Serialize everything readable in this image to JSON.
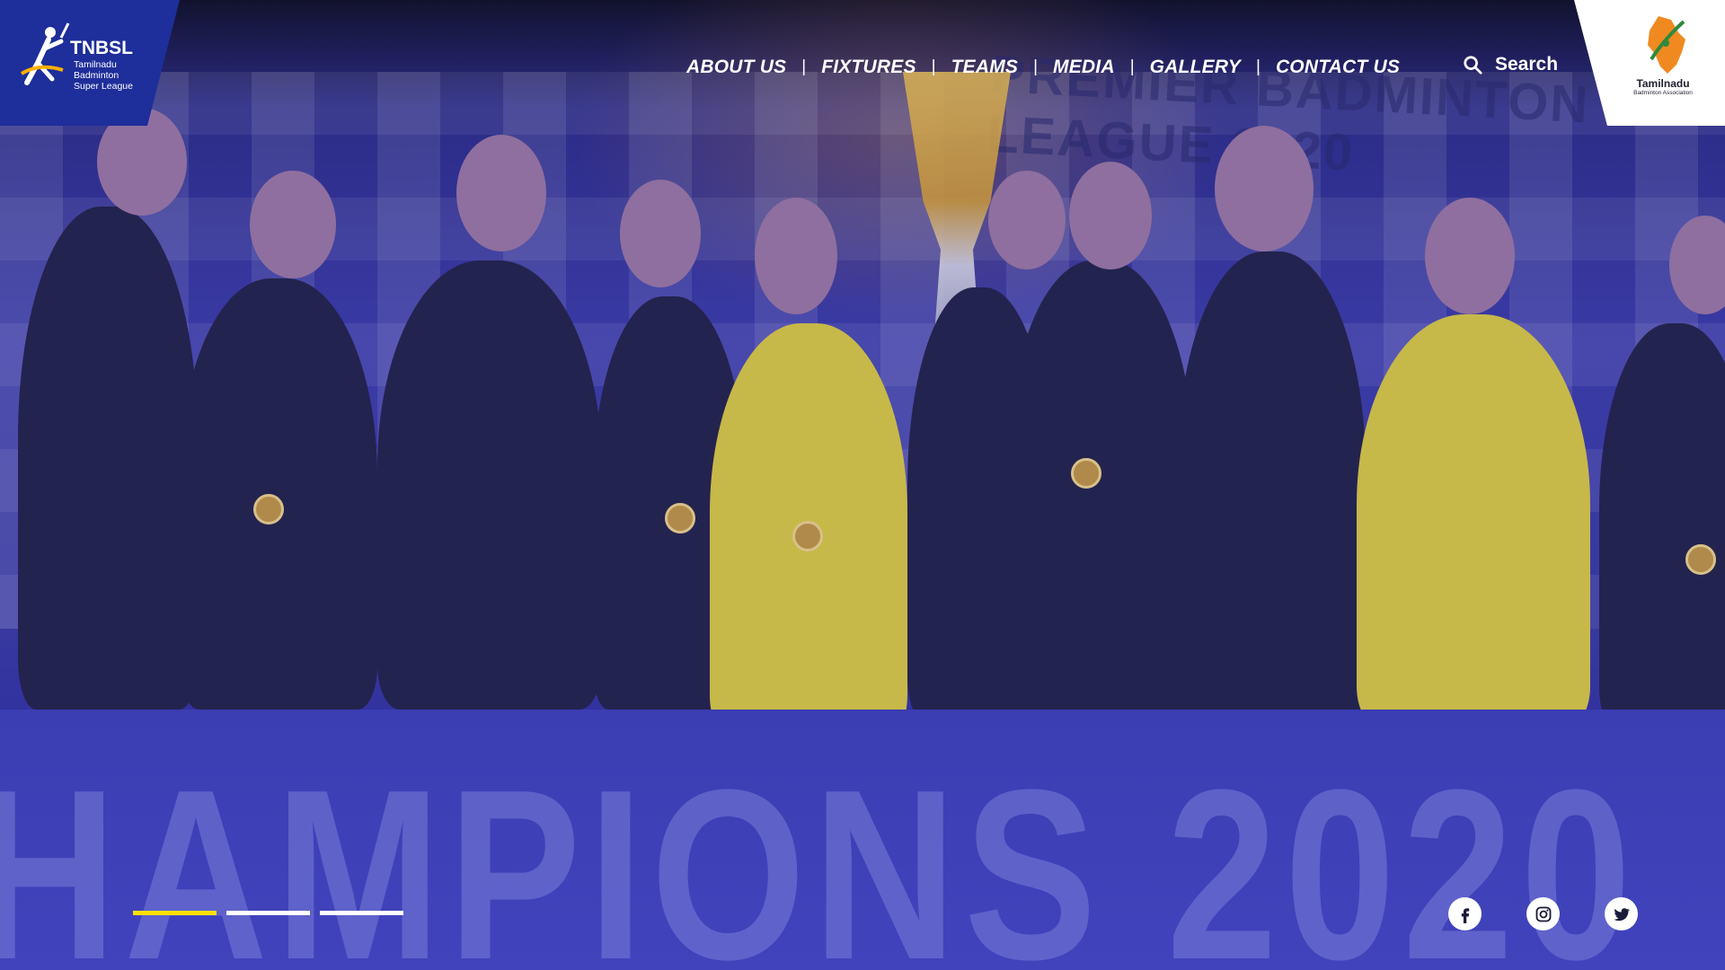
{
  "brand": {
    "left_logo": {
      "name": "TNBSL",
      "subtitle": "Tamilnadu Badminton Super League"
    },
    "right_logo": {
      "name": "Tamilnadu",
      "subtitle": "Badminton Association"
    }
  },
  "nav": {
    "items": [
      "ABOUT US",
      "FIXTURES",
      "TEAMS",
      "MEDIA",
      "GALLERY",
      "CONTACT US"
    ]
  },
  "search": {
    "label": "Search",
    "icon": "search-icon"
  },
  "hero": {
    "banner_text": "HAMPIONS 2020",
    "backdrop_text": "PREMIER BADMINTON LEAGUE 2020"
  },
  "slider": {
    "count": 3,
    "active_index": 0,
    "active_color": "#ffe000",
    "inactive_color": "#ffffff"
  },
  "social": [
    {
      "name": "facebook",
      "icon": "facebook-icon"
    },
    {
      "name": "instagram",
      "icon": "instagram-icon"
    },
    {
      "name": "twitter",
      "icon": "twitter-icon"
    }
  ],
  "colors": {
    "brand_blue": "#1e2e9a",
    "overlay_blue": "#3838a0",
    "accent_yellow": "#ffe000"
  }
}
